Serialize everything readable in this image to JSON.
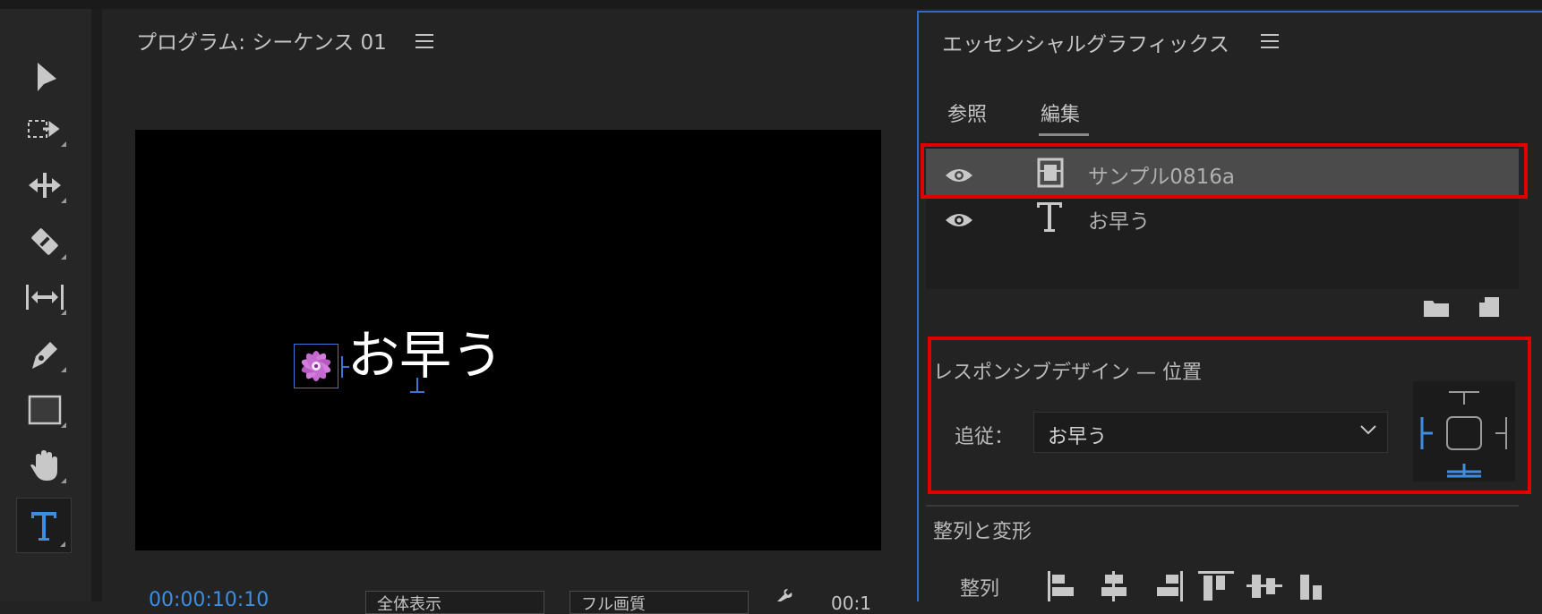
{
  "program_monitor": {
    "title": "プログラム: シーケンス 01",
    "overlay_text": "お早う",
    "timecode": "00:00:10:10",
    "zoom_select": "全体表示",
    "quality_select": "フル画質",
    "scale_readout": "00:1"
  },
  "tools": [
    {
      "name": "selection-tool",
      "icon": "arrow-icon"
    },
    {
      "name": "track-select-tool",
      "icon": "track-select-icon"
    },
    {
      "name": "ripple-edit-tool",
      "icon": "ripple-edit-icon"
    },
    {
      "name": "razor-tool",
      "icon": "razor-icon"
    },
    {
      "name": "slip-tool",
      "icon": "slip-icon"
    },
    {
      "name": "pen-tool",
      "icon": "pen-icon"
    },
    {
      "name": "rectangle-tool",
      "icon": "rectangle-icon"
    },
    {
      "name": "hand-tool",
      "icon": "hand-icon"
    },
    {
      "name": "type-tool",
      "icon": "type-icon",
      "active": true
    }
  ],
  "essential_graphics": {
    "title": "エッセンシャルグラフィックス",
    "tabs": [
      {
        "label": "参照",
        "active": false
      },
      {
        "label": "編集",
        "active": true
      }
    ],
    "layers": [
      {
        "name": "サンプル0816a",
        "type": "clip",
        "selected": true
      },
      {
        "name": "お早う",
        "type": "text",
        "selected": false
      }
    ],
    "responsive_design": {
      "title": "レスポンシブデザイン — 位置",
      "follow_label": "追従：",
      "follow_value": "お早う"
    },
    "align_transform": {
      "heading": "整列と変形",
      "align_label": "整列"
    }
  },
  "colors": {
    "accent_blue": "#3d8ee0",
    "highlight_red": "#e10000",
    "panel_bg": "#232323"
  }
}
